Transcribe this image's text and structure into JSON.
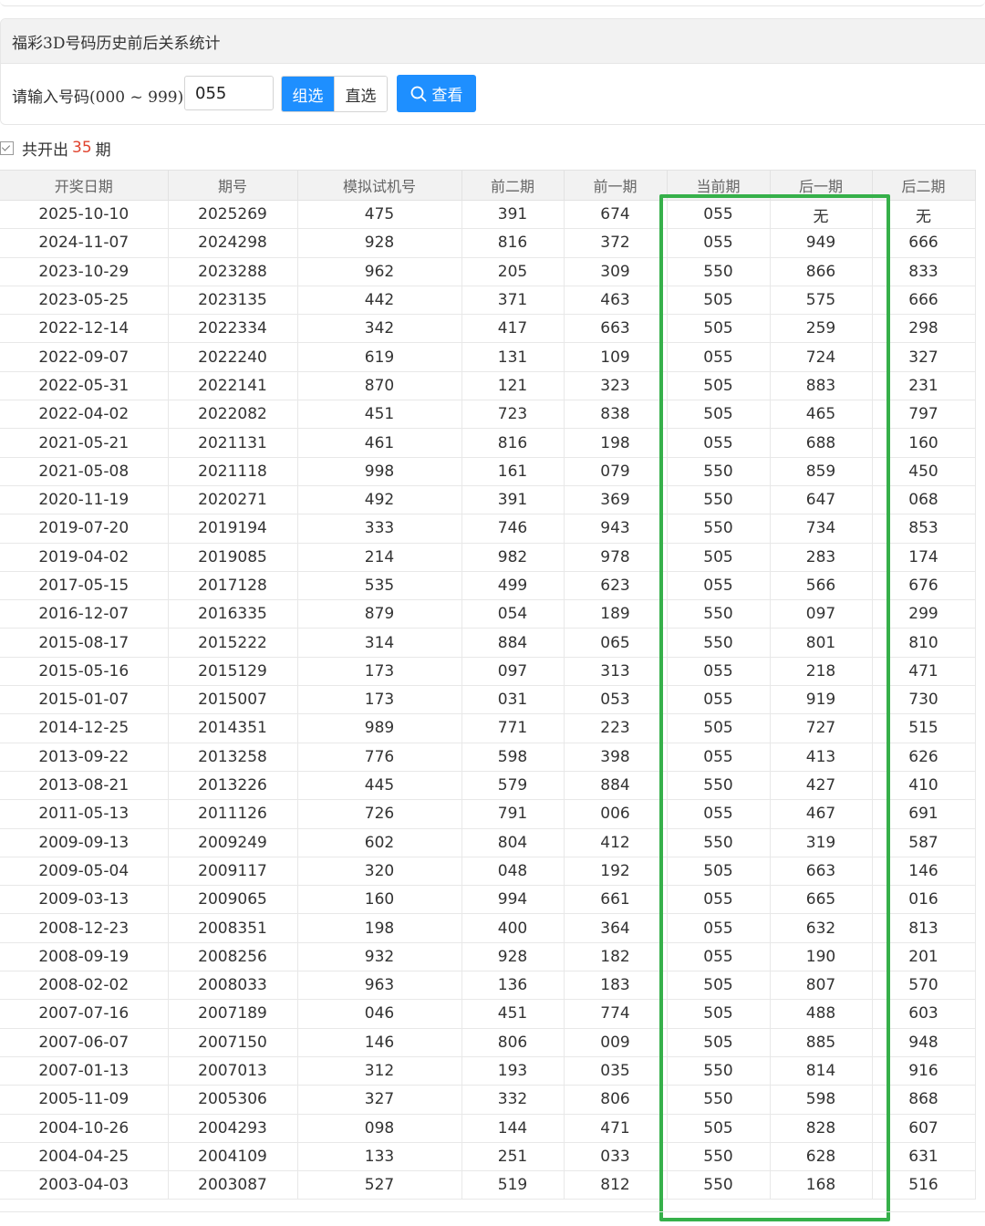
{
  "panel": {
    "title": "福彩3D号码历史前后关系统计",
    "input_label": "请输入号码(000 ~ 999)：",
    "input_value": "055",
    "mode_group": "组选",
    "mode_direct": "直选",
    "query_button": "查看",
    "accent_color": "#1e8fff"
  },
  "summary": {
    "prefix": "共开出",
    "count": "35",
    "suffix": "期"
  },
  "table": {
    "columns": [
      "开奖日期",
      "期号",
      "模拟试机号",
      "前二期",
      "前一期",
      "当前期",
      "后一期",
      "后二期"
    ],
    "rows": [
      [
        "2025-10-10",
        "2025269",
        "475",
        "391",
        "674",
        "055",
        "无",
        "无"
      ],
      [
        "2024-11-07",
        "2024298",
        "928",
        "816",
        "372",
        "055",
        "949",
        "666"
      ],
      [
        "2023-10-29",
        "2023288",
        "962",
        "205",
        "309",
        "550",
        "866",
        "833"
      ],
      [
        "2023-05-25",
        "2023135",
        "442",
        "371",
        "463",
        "505",
        "575",
        "666"
      ],
      [
        "2022-12-14",
        "2022334",
        "342",
        "417",
        "663",
        "505",
        "259",
        "298"
      ],
      [
        "2022-09-07",
        "2022240",
        "619",
        "131",
        "109",
        "055",
        "724",
        "327"
      ],
      [
        "2022-05-31",
        "2022141",
        "870",
        "121",
        "323",
        "505",
        "883",
        "231"
      ],
      [
        "2022-04-02",
        "2022082",
        "451",
        "723",
        "838",
        "505",
        "465",
        "797"
      ],
      [
        "2021-05-21",
        "2021131",
        "461",
        "816",
        "198",
        "055",
        "688",
        "160"
      ],
      [
        "2021-05-08",
        "2021118",
        "998",
        "161",
        "079",
        "550",
        "859",
        "450"
      ],
      [
        "2020-11-19",
        "2020271",
        "492",
        "391",
        "369",
        "550",
        "647",
        "068"
      ],
      [
        "2019-07-20",
        "2019194",
        "333",
        "746",
        "943",
        "550",
        "734",
        "853"
      ],
      [
        "2019-04-02",
        "2019085",
        "214",
        "982",
        "978",
        "505",
        "283",
        "174"
      ],
      [
        "2017-05-15",
        "2017128",
        "535",
        "499",
        "623",
        "055",
        "566",
        "676"
      ],
      [
        "2016-12-07",
        "2016335",
        "879",
        "054",
        "189",
        "550",
        "097",
        "299"
      ],
      [
        "2015-08-17",
        "2015222",
        "314",
        "884",
        "065",
        "550",
        "801",
        "810"
      ],
      [
        "2015-05-16",
        "2015129",
        "173",
        "097",
        "313",
        "055",
        "218",
        "471"
      ],
      [
        "2015-01-07",
        "2015007",
        "173",
        "031",
        "053",
        "055",
        "919",
        "730"
      ],
      [
        "2014-12-25",
        "2014351",
        "989",
        "771",
        "223",
        "505",
        "727",
        "515"
      ],
      [
        "2013-09-22",
        "2013258",
        "776",
        "598",
        "398",
        "055",
        "413",
        "626"
      ],
      [
        "2013-08-21",
        "2013226",
        "445",
        "579",
        "884",
        "550",
        "427",
        "410"
      ],
      [
        "2011-05-13",
        "2011126",
        "726",
        "791",
        "006",
        "055",
        "467",
        "691"
      ],
      [
        "2009-09-13",
        "2009249",
        "602",
        "804",
        "412",
        "550",
        "319",
        "587"
      ],
      [
        "2009-05-04",
        "2009117",
        "320",
        "048",
        "192",
        "505",
        "663",
        "146"
      ],
      [
        "2009-03-13",
        "2009065",
        "160",
        "994",
        "661",
        "055",
        "665",
        "016"
      ],
      [
        "2008-12-23",
        "2008351",
        "198",
        "400",
        "364",
        "055",
        "632",
        "813"
      ],
      [
        "2008-09-19",
        "2008256",
        "932",
        "928",
        "182",
        "055",
        "190",
        "201"
      ],
      [
        "2008-02-02",
        "2008033",
        "963",
        "136",
        "183",
        "505",
        "807",
        "570"
      ],
      [
        "2007-07-16",
        "2007189",
        "046",
        "451",
        "774",
        "505",
        "488",
        "603"
      ],
      [
        "2007-06-07",
        "2007150",
        "146",
        "806",
        "009",
        "505",
        "885",
        "948"
      ],
      [
        "2007-01-13",
        "2007013",
        "312",
        "193",
        "035",
        "550",
        "814",
        "916"
      ],
      [
        "2005-11-09",
        "2005306",
        "327",
        "332",
        "806",
        "550",
        "598",
        "868"
      ],
      [
        "2004-10-26",
        "2004293",
        "098",
        "144",
        "471",
        "505",
        "828",
        "607"
      ],
      [
        "2004-04-25",
        "2004109",
        "133",
        "251",
        "033",
        "550",
        "628",
        "631"
      ],
      [
        "2003-04-03",
        "2003087",
        "527",
        "519",
        "812",
        "550",
        "168",
        "516"
      ]
    ]
  },
  "highlight_color": "#36b04a"
}
